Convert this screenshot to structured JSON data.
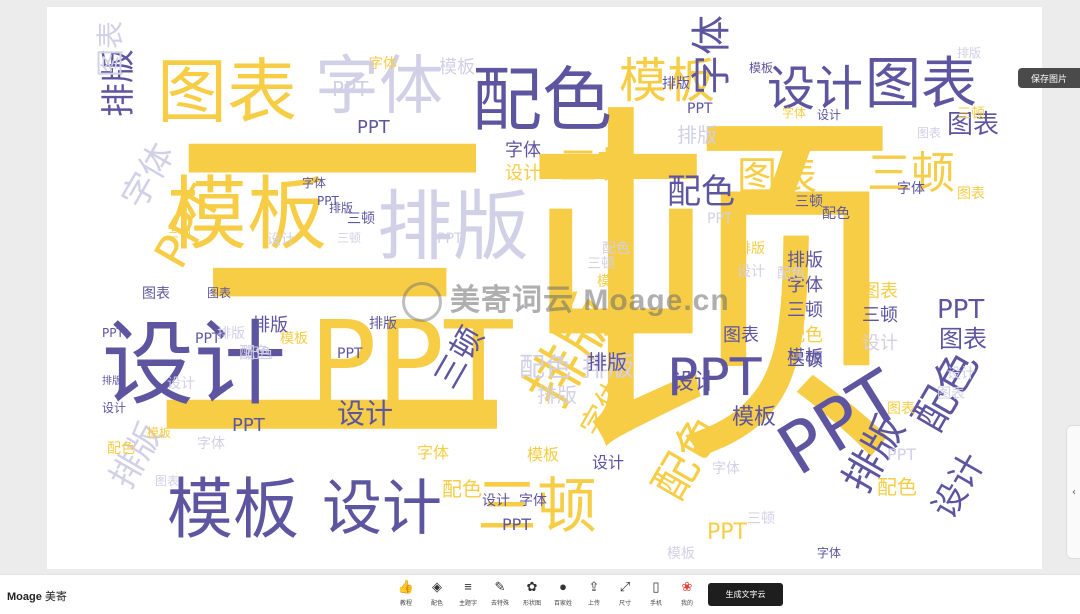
{
  "cloud": {
    "words": [
      "三顿",
      "PPT",
      "设计",
      "模板",
      "排版",
      "配色",
      "字体",
      "图表"
    ],
    "watermark": "美寄词云 Moage.cn",
    "colors": {
      "yellow": "#f6cd45",
      "purple": "#5d55a0",
      "lavender": "#d2d0e6"
    }
  },
  "side": {
    "save_label": "保存图片",
    "handle_icon": "chevron-left-icon"
  },
  "bottom": {
    "brand": "Moage",
    "brand_sub": "美寄",
    "tools": [
      {
        "label": "教程",
        "icon": "thumb-icon"
      },
      {
        "label": "配色",
        "icon": "paint-bucket-icon"
      },
      {
        "label": "主题字",
        "icon": "align-text-icon"
      },
      {
        "label": "去特殊",
        "icon": "filter-icon"
      },
      {
        "label": "形状图",
        "icon": "shape-icon"
      },
      {
        "label": "百家姓",
        "icon": "surname-icon"
      },
      {
        "label": "上传",
        "icon": "upload-icon"
      },
      {
        "label": "尺寸",
        "icon": "resize-icon"
      },
      {
        "label": "手机",
        "icon": "phone-icon"
      },
      {
        "label": "我的",
        "icon": "user-icon"
      }
    ],
    "generate_label": "生成文字云"
  }
}
